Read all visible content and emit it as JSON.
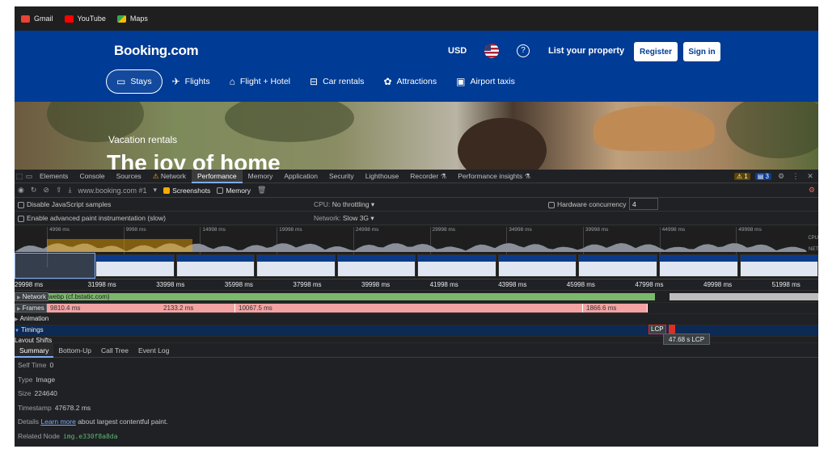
{
  "bookmarks": [
    {
      "label": "Gmail",
      "icon": "gmail-icon",
      "color": "#ea4335"
    },
    {
      "label": "YouTube",
      "icon": "youtube-icon",
      "color": "#ff0000"
    },
    {
      "label": "Maps",
      "icon": "maps-icon",
      "color": "#34a853"
    }
  ],
  "booking": {
    "logo": "Booking.com",
    "currency": "USD",
    "help_glyph": "?",
    "list_property": "List your property",
    "register": "Register",
    "sign_in": "Sign in",
    "nav": [
      {
        "label": "Stays",
        "icon": "bed-icon",
        "glyph": "🛏",
        "active": true
      },
      {
        "label": "Flights",
        "icon": "plane-icon",
        "glyph": "✈",
        "active": false
      },
      {
        "label": "Flight + Hotel",
        "icon": "flight-hotel-icon",
        "glyph": "⛳",
        "active": false
      },
      {
        "label": "Car rentals",
        "icon": "car-icon",
        "glyph": "🚗",
        "active": false
      },
      {
        "label": "Attractions",
        "icon": "attractions-icon",
        "glyph": "✿",
        "active": false
      },
      {
        "label": "Airport taxis",
        "icon": "taxi-icon",
        "glyph": "🚕",
        "active": false
      }
    ],
    "hero_sub": "Vacation rentals",
    "hero_title": "The joy of home"
  },
  "devtools": {
    "tabs": [
      "Elements",
      "Console",
      "Sources",
      "Network",
      "Performance",
      "Memory",
      "Application",
      "Security",
      "Lighthouse",
      "Recorder",
      "Performance insights"
    ],
    "active_tab": "Performance",
    "warnings": "1",
    "messages": "3",
    "toolbar": {
      "url": "www.booking.com #1",
      "screenshots": "Screenshots",
      "memory": "Memory"
    },
    "settings": {
      "disable_js": "Disable JavaScript samples",
      "cpu_label": "CPU:",
      "cpu_value": "No throttling",
      "hw_label": "Hardware concurrency",
      "hw_value": "4",
      "paint": "Enable advanced paint instrumentation (slow)",
      "network_label": "Network:",
      "network_value": "Slow 3G"
    },
    "overview_ticks": [
      "4998 ms",
      "9998 ms",
      "14998 ms",
      "19998 ms",
      "24998 ms",
      "29998 ms",
      "34998 ms",
      "39998 ms",
      "44998 ms",
      "49998 ms"
    ],
    "overview_side": [
      "CPU",
      "NET"
    ],
    "ruler_ticks": [
      "29998 ms",
      "31998 ms",
      "33998 ms",
      "35998 ms",
      "37998 ms",
      "39998 ms",
      "41998 ms",
      "43998 ms",
      "45998 ms",
      "47998 ms",
      "49998 ms",
      "51998 ms"
    ],
    "tracks": {
      "network": "Network",
      "network_item": "webp (cf.bstatic.com)",
      "frames": "Frames",
      "frame_segments": [
        "9810.4 ms",
        "2133.2 ms",
        "10067.5 ms",
        "1866.6 ms"
      ],
      "animation": "Animation",
      "timings": "Timings",
      "layout_shifts": "Layout Shifts"
    },
    "lcp": {
      "marker": "LCP",
      "tooltip": "47.68 s LCP"
    },
    "summary_tabs": [
      "Summary",
      "Bottom-Up",
      "Call Tree",
      "Event Log"
    ],
    "details": {
      "self_time_label": "Self Time",
      "self_time": "0",
      "type_label": "Type",
      "type": "Image",
      "size_label": "Size",
      "size": "224640",
      "timestamp_label": "Timestamp",
      "timestamp": "47678.2 ms",
      "details_label": "Details",
      "learn_more": "Learn more",
      "details_text": "about largest contentful paint.",
      "node_label": "Related Node",
      "node": "img.e330f8a8da"
    }
  }
}
